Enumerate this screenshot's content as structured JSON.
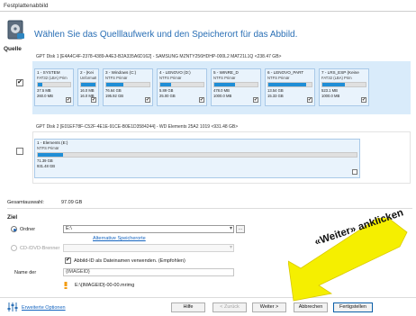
{
  "window": {
    "title": "Festplattenabbild"
  },
  "header": {
    "text": "Wählen Sie das Quelllaufwerk und den Speicherort für das Abbild."
  },
  "source": {
    "label": "Quelle",
    "disks": [
      {
        "title": "GPT Disk 1 [E4A4C4F-2378-4389-A4E3-B2A335A6D162] - SAMSUNG MZNTY256HDHP-000L2 MAT21L1Q  <238.47 GB>",
        "checked": "✔",
        "partitions": [
          {
            "name": "1 - SYSTEM",
            "fs": "FAT32 (LBA) Prim",
            "used": "37.5 MB",
            "total": "260.0 MB",
            "fill": 0.14,
            "check": "✔"
          },
          {
            "name": "2 - (Kei",
            "fs": "Unformatted",
            "used": "16.0 MB",
            "total": "16.0 MB",
            "fill": 1.0,
            "check": "✔"
          },
          {
            "name": "3 - Windows (C:)",
            "fs": "NTFS Primär",
            "used": "76.64 GB",
            "total": "195.92 GB",
            "fill": 0.39,
            "check": "✔"
          },
          {
            "name": "4 - LENOVO (D:)",
            "fs": "NTFS Primär",
            "used": "5.89 GB",
            "total": "25.00 GB",
            "fill": 0.24,
            "check": "✔"
          },
          {
            "name": "5 - WINRE_D",
            "fs": "NTFS Primär",
            "used": "478.0 MB",
            "total": "1000.0 MB",
            "fill": 0.48,
            "check": "✔"
          },
          {
            "name": "6 - LENOVO_PART",
            "fs": "NTFS Primär",
            "used": "13.54 GB",
            "total": "15.33 GB",
            "fill": 0.88,
            "check": "✔"
          },
          {
            "name": "7 - LRS_ESP (Keine",
            "fs": "FAT32 (LBA) Prim",
            "used": "523.1 MB",
            "total": "1000.0 MB",
            "fill": 0.52,
            "check": "✔"
          }
        ]
      },
      {
        "title": "GPT Disk 2 [E01EF78F-C52F-4E1E-91CE-B0E1D3584244] - WD      Elements 25A2    1019  <931.48 GB>",
        "checked": "",
        "partitions": [
          {
            "name": "1 - Elements (E:)",
            "fs": "NTFS Primär",
            "used": "71.39 GB",
            "total": "931.48 GB",
            "fill": 0.08,
            "check": ""
          }
        ]
      }
    ]
  },
  "total": {
    "label": "Gesamtauswahl:",
    "value": "97.09 GB"
  },
  "destination": {
    "label": "Ziel",
    "folder_label": "Ordner",
    "folder_value": "E:\\",
    "browse_label": "...",
    "alt_locations_link": "Alternative Speicherorte",
    "cd_label": "CD-/DVD-Brenner",
    "use_id_label": "Abbild-ID als Dateinamen verwenden. (Empfohlen)",
    "use_id_checked": "✔",
    "name_label": "Name der",
    "name_placeholder": "{IMAGEID}",
    "path_preview": "E:\\{IMAGEID}-00-00.mrimg"
  },
  "footer": {
    "advanced_options": "Erweiterte Optionen",
    "buttons": {
      "help": "Hilfe",
      "back": "< Zurück",
      "next": "Weiter >",
      "cancel": "Abbrechen",
      "finish": "Fertigstellen"
    }
  },
  "annotation": {
    "text": "«Weiter» anklicken",
    "color": "#f5ef00"
  },
  "colors": {
    "accent": "#2a6fb5",
    "disk_bg": "#d9ebfa",
    "bar_fill": "#1f8ed6"
  }
}
